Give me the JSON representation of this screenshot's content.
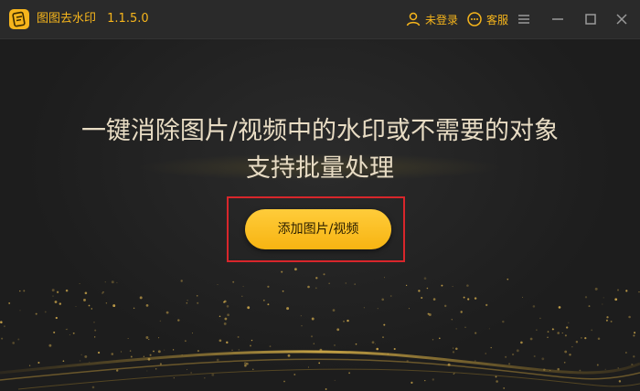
{
  "app": {
    "title": "图图去水印",
    "version": "1.1.5.0",
    "accent": "#f6b51c"
  },
  "titlebar": {
    "login_label": "未登录",
    "service_label": "客服",
    "icons": [
      "user-icon",
      "chat-icon",
      "menu-icon",
      "minimize-icon",
      "maximize-icon",
      "close-icon"
    ]
  },
  "main": {
    "headline": "一键消除图片/视频中的水印或不需要的对象",
    "subheadline": "支持批量处理",
    "add_button_label": "添加图片/视频",
    "highlight_color": "#d8262b"
  }
}
